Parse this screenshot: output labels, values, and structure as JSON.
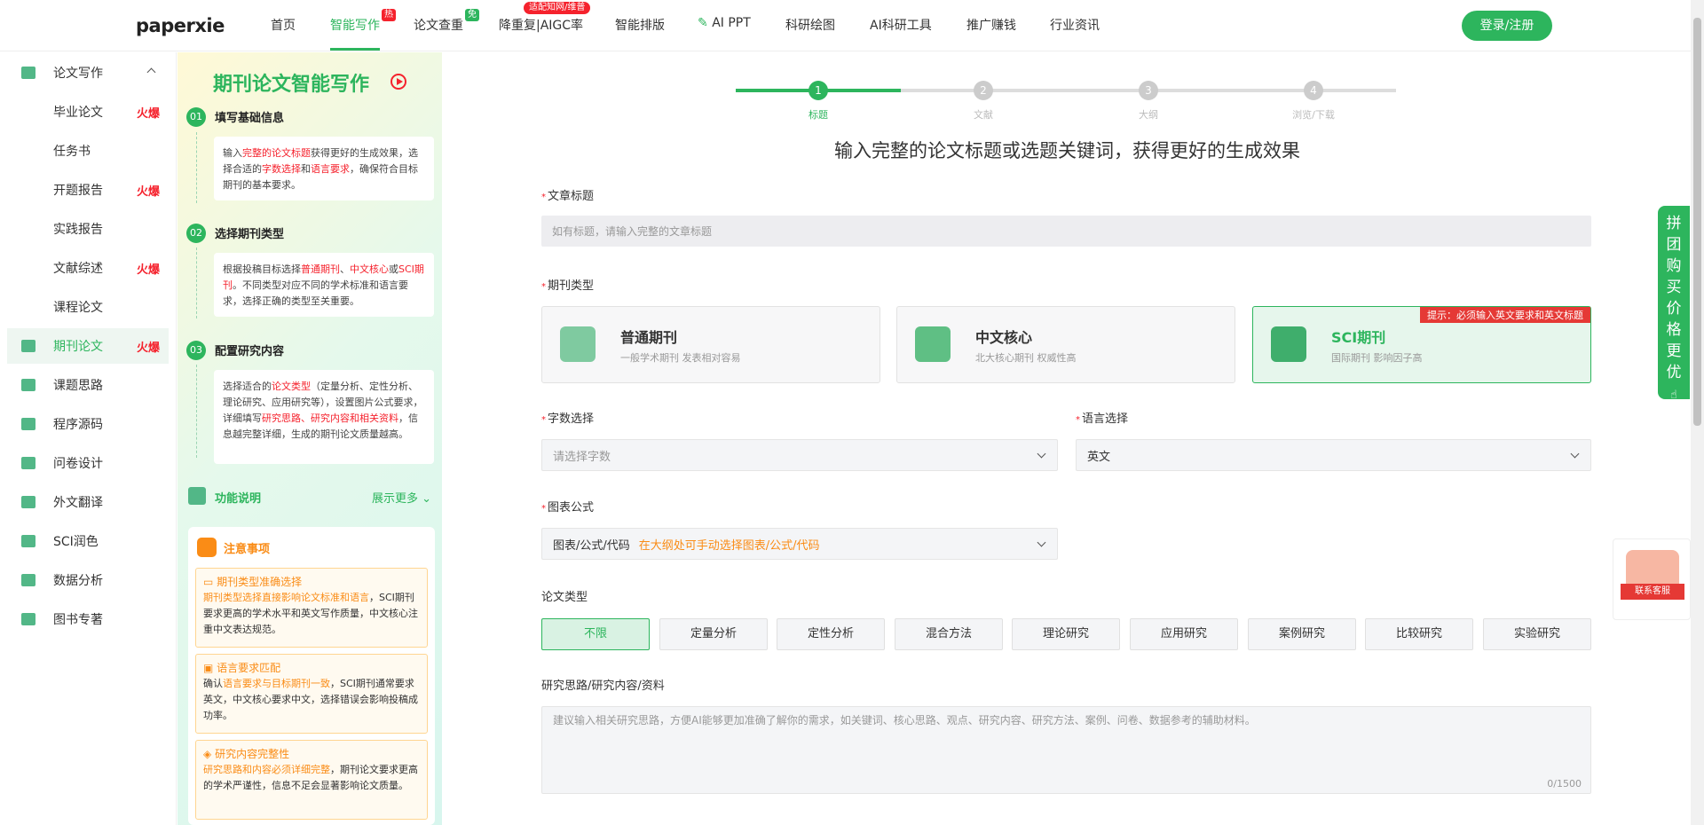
{
  "header": {
    "logo": "paperxie",
    "nav": [
      {
        "label": "首页"
      },
      {
        "label": "智能写作",
        "badge": "热"
      },
      {
        "label": "论文查重",
        "badge": "免"
      },
      {
        "label": "降重复|AIGC率",
        "badge": "适配知网/维普"
      },
      {
        "label": "智能排版"
      },
      {
        "label": "AI PPT"
      },
      {
        "label": "科研绘图"
      },
      {
        "label": "AI科研工具"
      },
      {
        "label": "推广赚钱"
      },
      {
        "label": "行业资讯"
      }
    ],
    "login": "登录/注册"
  },
  "sidebar": {
    "group": "论文写作",
    "subitems": [
      {
        "label": "毕业论文",
        "hot": "火爆"
      },
      {
        "label": "任务书",
        "hot": ""
      },
      {
        "label": "开题报告",
        "hot": "火爆"
      },
      {
        "label": "实践报告",
        "hot": ""
      },
      {
        "label": "文献综述",
        "hot": "火爆"
      },
      {
        "label": "课程论文",
        "hot": ""
      },
      {
        "label": "期刊论文",
        "hot": "火爆"
      }
    ],
    "items": [
      {
        "label": "课题思路"
      },
      {
        "label": "程序源码"
      },
      {
        "label": "问卷设计"
      },
      {
        "label": "外文翻译"
      },
      {
        "label": "SCI润色"
      },
      {
        "label": "数据分析"
      },
      {
        "label": "图书专著"
      }
    ]
  },
  "guide": {
    "title": "期刊论文智能写作",
    "steps": [
      {
        "num": "01",
        "title": "填写基础信息"
      },
      {
        "num": "02",
        "title": "选择期刊类型"
      },
      {
        "num": "03",
        "title": "配置研究内容"
      }
    ],
    "step1": {
      "a": "输入",
      "b": "完整的论文标题",
      "c": "获得更好的生成效果，选择合适的",
      "d": "字数选择",
      "e": "和",
      "f": "语言要求",
      "g": "，确保符合目标期刊的基本要求。"
    },
    "step2": {
      "a": "根据投稿目标选择",
      "b": "普通期刊",
      "c": "、",
      "d": "中文核心",
      "e": "或",
      "f": "SCI期刊",
      "g": "。不同类型对应不同的学术标准和语言要求，选择正确的类型至关重要。"
    },
    "step3": {
      "a": "选择适合的",
      "b": "论文类型",
      "c": "（定量分析、定性分析、理论研究、应用研究等），设置图片公式要求，详细填写",
      "d": "研究思路、研究内容和相关资料",
      "e": "，信息越完整详细，生成的期刊论文质量越高。"
    },
    "func_label": "功能说明",
    "show_more": "展示更多",
    "notice_title": "注意事项",
    "notices": [
      {
        "title": "期刊类型准确选择",
        "hl": "期刊类型选择直接影响论文标准和语言",
        "rest": "，SCI期刊要求更高的学术水平和英文写作质量，中文核心注重中文表达规范。"
      },
      {
        "title": "语言要求匹配",
        "pre": "确认",
        "hl": "语言要求与目标期刊一致",
        "rest": "，SCI期刊通常要求英文，中文核心要求中文，选择错误会影响投稿成功率。"
      },
      {
        "title": "研究内容完整性",
        "hl": "研究思路和内容必须详细完整",
        "rest": "，期刊论文要求更高的学术严谨性，信息不足会显著影响论文质量。"
      }
    ]
  },
  "progress": {
    "steps": [
      {
        "num": "1",
        "label": "标题"
      },
      {
        "num": "2",
        "label": "文献"
      },
      {
        "num": "3",
        "label": "大纲"
      },
      {
        "num": "4",
        "label": "浏览/下载"
      }
    ],
    "current_step": 1
  },
  "form": {
    "headline": "输入完整的论文标题或选题关键词，获得更好的生成效果",
    "title_label": "文章标题",
    "title_placeholder": "如有标题，请输入完整的文章标题",
    "journal_label": "期刊类型",
    "journals": [
      {
        "name": "普通期刊",
        "desc": "一般学术期刊 发表相对容易"
      },
      {
        "name": "中文核心",
        "desc": "北大核心期刊 权威性高"
      },
      {
        "name": "SCI期刊",
        "desc": "国际期刊 影响因子高"
      }
    ],
    "sci_tip": "提示：必须输入英文要求和英文标题",
    "wordcount_label": "字数选择",
    "wordcount_placeholder": "请选择字数",
    "language_label": "语言选择",
    "language_value": "英文",
    "chart_label": "图表公式",
    "chart_value": "图表/公式/代码",
    "chart_hint": "在大纲处可手动选择图表/公式/代码",
    "type_label": "论文类型",
    "types": [
      "不限",
      "定量分析",
      "定性分析",
      "混合方法",
      "理论研究",
      "应用研究",
      "案例研究",
      "比较研究",
      "实验研究"
    ],
    "research_label": "研究思路/研究内容/资料",
    "research_placeholder": "建议输入相关研究思路，方便AI能够更加准确了解你的需求，如关键词、核心思路、观点、研究内容、研究方法、案例、问卷、数据参考的辅助材料。",
    "counter": "0/1500"
  },
  "float": {
    "groupbuy": "拼团购买 价格更优",
    "cs": "联系客服"
  },
  "colors": {
    "accent": "#2db55d",
    "hot": "#f5222d",
    "tip": "#e53935",
    "warn": "#fa8c16"
  }
}
